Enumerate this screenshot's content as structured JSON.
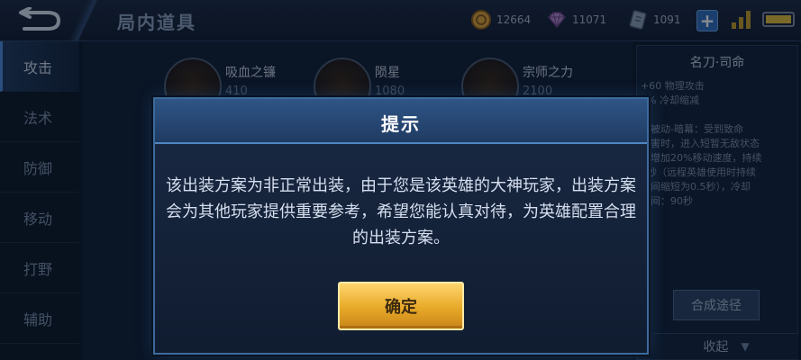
{
  "header": {
    "title": "局内道具",
    "back_icon": "back-arrow-icon",
    "currencies": [
      {
        "icon": "gold-coin-icon",
        "value": "12664",
        "color": "#e0a53a"
      },
      {
        "icon": "diamond-icon",
        "value": "11071",
        "color": "#b58ad0"
      },
      {
        "icon": "voucher-icon",
        "value": "1091",
        "color": "#8fa3bd"
      }
    ],
    "add_icon": "plus-icon",
    "signal_icon": "signal-icon",
    "battery_icon": "battery-icon",
    "battery_level": 1.0
  },
  "sidebar": {
    "items": [
      {
        "label": "攻击",
        "active": true
      },
      {
        "label": "法术",
        "active": false
      },
      {
        "label": "防御",
        "active": false
      },
      {
        "label": "移动",
        "active": false
      },
      {
        "label": "打野",
        "active": false
      },
      {
        "label": "辅助",
        "active": false
      }
    ]
  },
  "items": [
    {
      "name": "吸血之镰",
      "price": "410"
    },
    {
      "name": "陨星",
      "price": "1080"
    },
    {
      "name": "宗师之力",
      "price": "2100"
    }
  ],
  "detail": {
    "name": "名刀·司命",
    "lines": [
      "+60 物理攻击",
      "5% 冷却缩减",
      "一被动-暗幕：受到致命",
      "伤害时，进入短暂无敌状态",
      "并增加20%移动速度，持续",
      "1秒（远程英雄使用时持续",
      "时间缩短为0.5秒），冷却",
      "时间：90秒"
    ],
    "compose_label": "合成途径"
  },
  "collapse_label": "收起",
  "dialog": {
    "title": "提示",
    "message": "该出装方案为非正常出装，由于您是该英雄的大神玩家，出装方案会为其他玩家提供重要参考，希望您能认真对待，为英雄配置合理的出装方案。",
    "confirm_label": "确定"
  },
  "colors": {
    "accent_blue": "#3c6a9d",
    "confirm_gold": "#e7a927",
    "background": "#0e1a2c"
  }
}
